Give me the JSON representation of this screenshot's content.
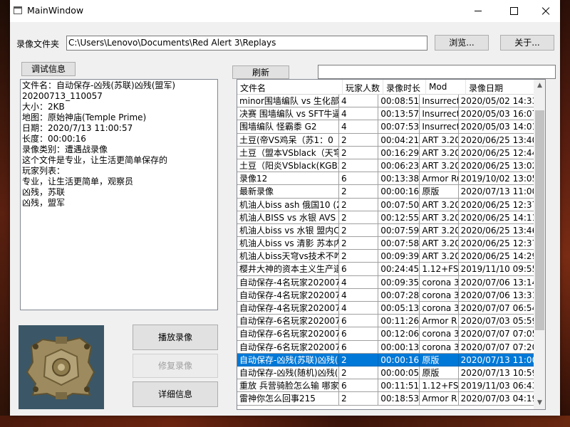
{
  "window": {
    "title": "MainWindow"
  },
  "folder": {
    "label": "录像文件夹",
    "path": "C:\\Users\\Lenovo\\Documents\\Red Alert 3\\Replays",
    "browse_label": "浏览...",
    "about_label": "关于..."
  },
  "debug_label": "调试信息",
  "refresh_label": "刷新",
  "filter": {
    "value": ""
  },
  "info_lines": [
    "文件名：自动保存-凶残(苏联)凶残(盟军)",
    "20200713_110057",
    "大小：2KB",
    "地图：原始神庙(Temple Prime)",
    "日期：2020/7/13 11:00:57",
    "长度：00:00:16",
    "录像类别：遭遇战录像",
    "这个文件是专业，让生活更简单保存的",
    "玩家列表：",
    "专业，让生活更简单，观察员",
    "凶残，苏联",
    "凶残，盟军"
  ],
  "minimap": {
    "name": "Temple Prime"
  },
  "actions": {
    "play_label": "播放录像",
    "repair_label": "修复录像",
    "details_label": "详细信息"
  },
  "table": {
    "columns": [
      "文件名",
      "玩家人数",
      "录像时长",
      "Mod",
      "录像日期"
    ],
    "rows": [
      [
        "minor围墙编队 vs 生化部队",
        "4",
        "00:08:51",
        "Insurrection",
        "2020/05/02 14:33:"
      ],
      [
        "决赛 围墙编队 vs SFT牛逼",
        "4",
        "00:13:57",
        "Insurrection",
        "2020/05/03 16:07:"
      ],
      [
        "围墙编队 怪霸黍 G2",
        "4",
        "00:07:53",
        "Insurrection",
        "2020/05/03 14:01:"
      ],
      [
        "土豆(帝VS鸡呆（苏1：0",
        "2",
        "00:04:21",
        "ART 3.20",
        "2020/06/25 13:40:"
      ],
      [
        "土豆（盟本VSblack（天穹",
        "2",
        "00:16:29",
        "ART 3.20",
        "2020/06/25 12:44:"
      ],
      [
        "土豆（阳炎VSblack(KGB2",
        "2",
        "00:06:23",
        "ART 3.20",
        "2020/06/25 13:02:"
      ],
      [
        "录像12",
        "6",
        "00:13:38",
        "Armor Rush",
        "2019/10/02 13:05:"
      ],
      [
        "最新录像",
        "2",
        "00:00:16",
        "原版",
        "2020/07/13 11:00:"
      ],
      [
        "机油人biss ash 俄国10 (2)",
        "2",
        "00:07:50",
        "ART 3.20",
        "2020/06/25 12:37:"
      ],
      [
        "机油人BISS vs 水银 AVS IF",
        "2",
        "00:12:55",
        "ART 3.20",
        "2020/06/25 14:11:"
      ],
      [
        "机油人biss vs 水银 盟内CF",
        "2",
        "00:07:59",
        "ART 3.20",
        "2020/06/25 13:46:"
      ],
      [
        "机油人biss vs 清影 苏本内",
        "2",
        "00:07:58",
        "ART 3.20",
        "2020/06/25 12:37:"
      ],
      [
        "机油人biss天穹vs技术不咋",
        "2",
        "00:09:39",
        "ART 3.20",
        "2020/06/25 14:29:"
      ],
      [
        "樱井大神的资本主义生产道",
        "6",
        "00:24:45",
        "1.12+FS",
        "2019/11/10 09:55:"
      ],
      [
        "自动保存-4名玩家2020070",
        "4",
        "00:09:35",
        "corona 3",
        "2020/07/06 13:14:"
      ],
      [
        "自动保存-4名玩家2020070",
        "4",
        "00:07:28",
        "corona 3",
        "2020/07/06 13:31:"
      ],
      [
        "自动保存-4名玩家2020070",
        "4",
        "00:05:13",
        "corona 3",
        "2020/07/07 06:54:"
      ],
      [
        "自动保存-6名玩家2020070",
        "6",
        "00:11:26",
        "Armor R",
        "2020/07/03 05:59:"
      ],
      [
        "自动保存-6名玩家2020070",
        "6",
        "00:12:06",
        "corona 3",
        "2020/07/07 07:05:"
      ],
      [
        "自动保存-6名玩家2020070",
        "6",
        "00:00:13",
        "corona 3",
        "2020/07/07 07:20:"
      ],
      [
        "自动保存-凶残(苏联)凶残(盟",
        "2",
        "00:00:16",
        "原版",
        "2020/07/13 11:00:"
      ],
      [
        "自动保存-凶残(随机)凶残(随",
        "2",
        "00:00:05",
        "原版",
        "2020/07/13 10:59:"
      ],
      [
        "重放 兵营骑脸怎么输 哪家",
        "6",
        "00:11:51",
        "1.12+FS",
        "2019/11/03 06:43:"
      ],
      [
        "雷神你怎么回事215",
        "2",
        "00:18:53",
        "Armor R",
        "2020/07/03 04:19:"
      ]
    ],
    "selected_index": 20
  },
  "scroll": {
    "position": 0.22,
    "visible_fraction": 0.72
  }
}
